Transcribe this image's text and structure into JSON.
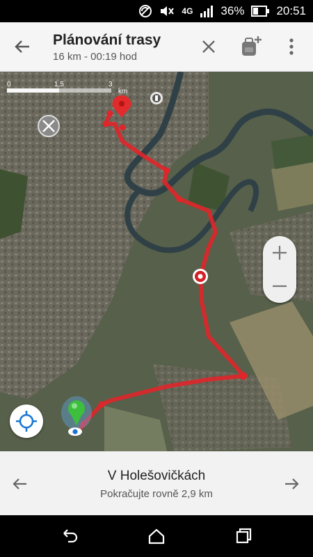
{
  "status_bar": {
    "network": "4G",
    "battery": "36%",
    "time": "20:51"
  },
  "header": {
    "title": "Plánování trasy",
    "subtitle": "16 km - 00:19 hod"
  },
  "map": {
    "scale_labels": [
      "0",
      "1,5",
      "3"
    ],
    "scale_unit": "km",
    "route_color": "#e0262a"
  },
  "navigation": {
    "street": "V Holešovičkách",
    "instruction": "Pokračujte rovně 2,9 km"
  },
  "colors": {
    "route": "#e0262a",
    "accent": "#1976d2",
    "pin": "#e32b2b",
    "start_marker": "#3dbf3d"
  }
}
